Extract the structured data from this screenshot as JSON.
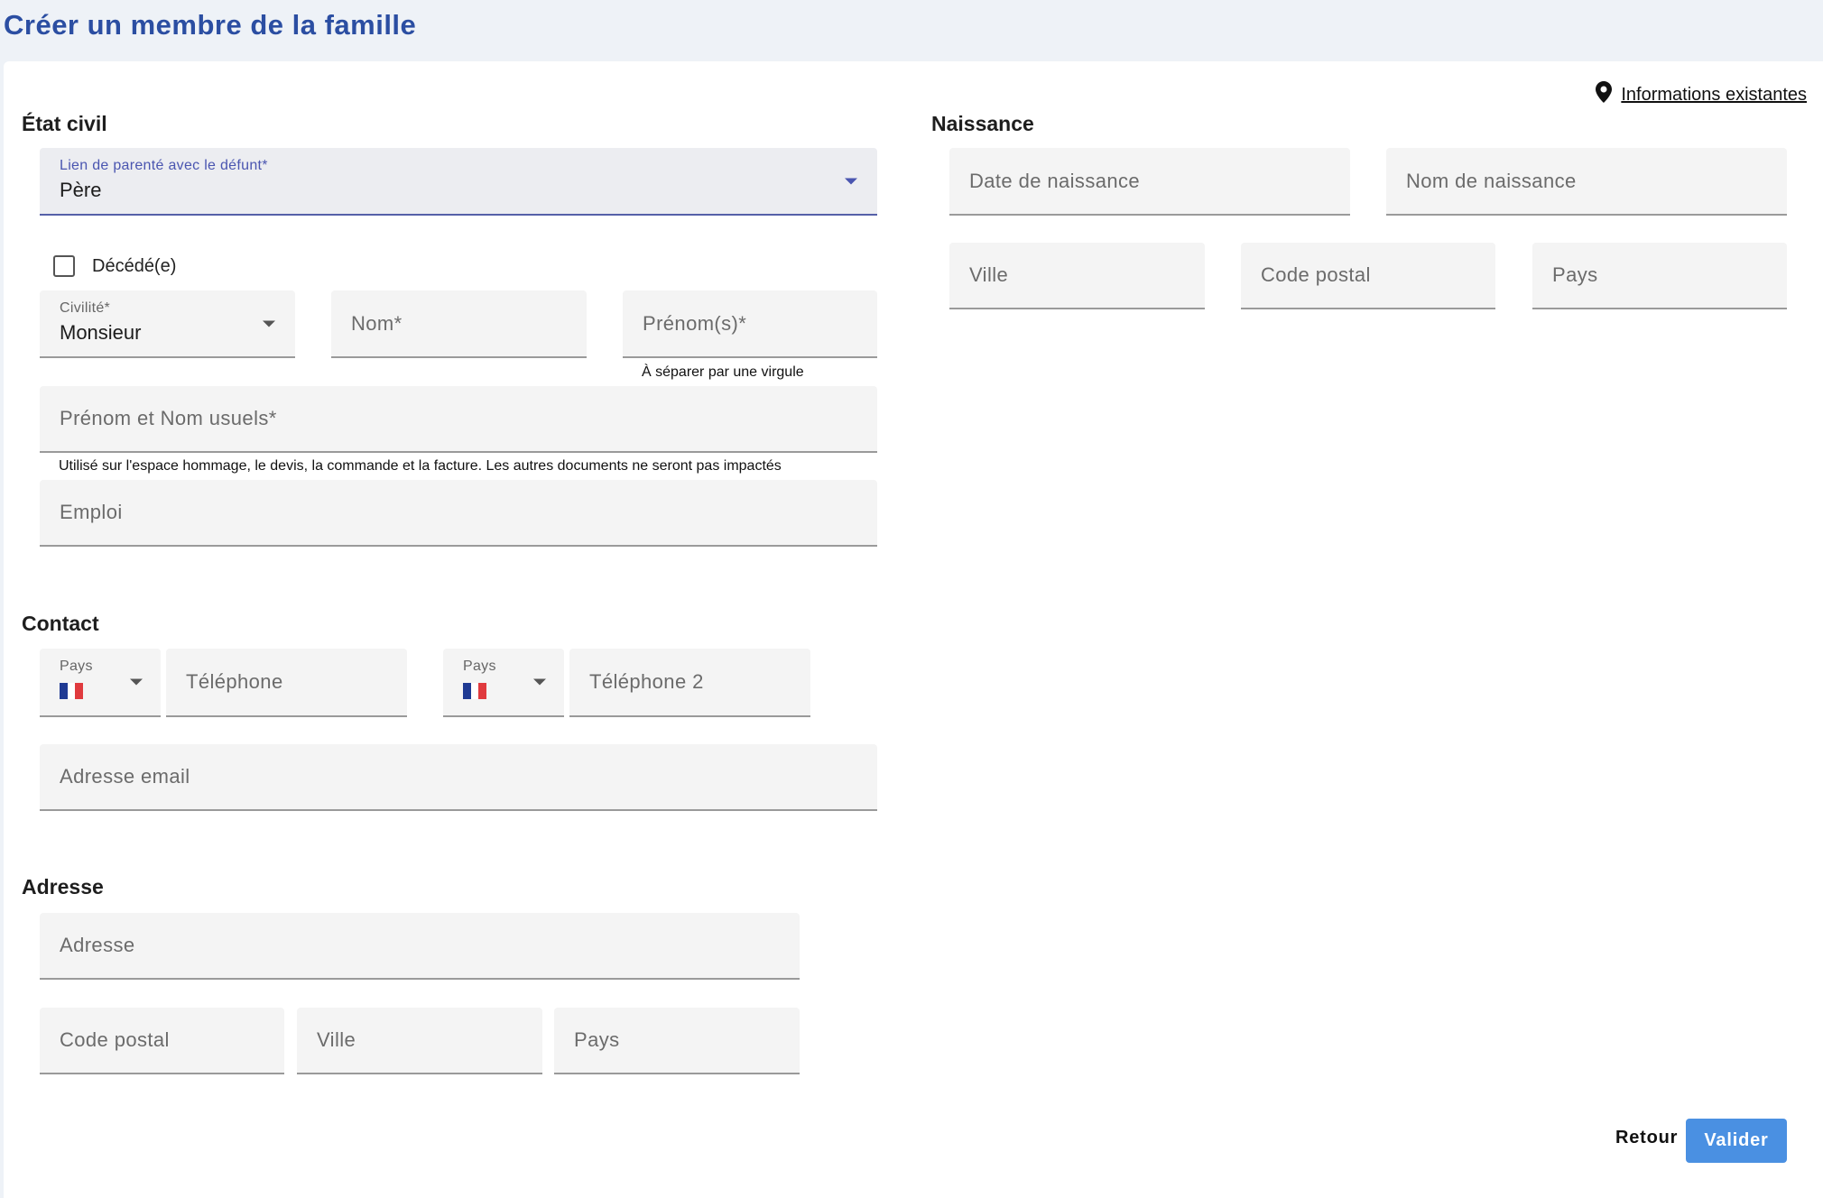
{
  "page": {
    "title": "Créer un membre de la famille"
  },
  "info_link": {
    "label": "Informations existantes",
    "icon": "map-pin-icon"
  },
  "etat_civil": {
    "title": "État civil",
    "lien": {
      "label": "Lien de parenté avec le défunt*",
      "value": "Père"
    },
    "decede": {
      "label": "Décédé(e)",
      "checked": false
    },
    "civilite": {
      "label": "Civilité*",
      "value": "Monsieur"
    },
    "nom": {
      "placeholder": "Nom*"
    },
    "prenoms": {
      "placeholder": "Prénom(s)*",
      "hint": "À séparer par une virgule"
    },
    "usuels": {
      "placeholder": "Prénom et Nom usuels*",
      "hint": "Utilisé sur l'espace hommage, le devis, la commande et la facture. Les autres documents ne seront pas impactés"
    },
    "emploi": {
      "placeholder": "Emploi"
    }
  },
  "contact": {
    "title": "Contact",
    "pays1": {
      "label": "Pays",
      "flag": "france-flag"
    },
    "telephone": {
      "placeholder": "Téléphone"
    },
    "pays2": {
      "label": "Pays",
      "flag": "france-flag"
    },
    "telephone2": {
      "placeholder": "Téléphone 2"
    },
    "email": {
      "placeholder": "Adresse email"
    }
  },
  "adresse": {
    "title": "Adresse",
    "adresse": {
      "placeholder": "Adresse"
    },
    "code_postal": {
      "placeholder": "Code postal"
    },
    "ville": {
      "placeholder": "Ville"
    },
    "pays": {
      "placeholder": "Pays"
    }
  },
  "naissance": {
    "title": "Naissance",
    "date": {
      "placeholder": "Date de naissance"
    },
    "nom": {
      "placeholder": "Nom de naissance"
    },
    "ville": {
      "placeholder": "Ville"
    },
    "code_postal": {
      "placeholder": "Code postal"
    },
    "pays": {
      "placeholder": "Pays"
    }
  },
  "actions": {
    "retour": "Retour",
    "valider": "Valider"
  },
  "colors": {
    "accent": "#2b4ea2",
    "button": "#4a90e2",
    "focus": "#5560a8",
    "flag_blue": "#1f3a93",
    "flag_red": "#e03a3e"
  }
}
